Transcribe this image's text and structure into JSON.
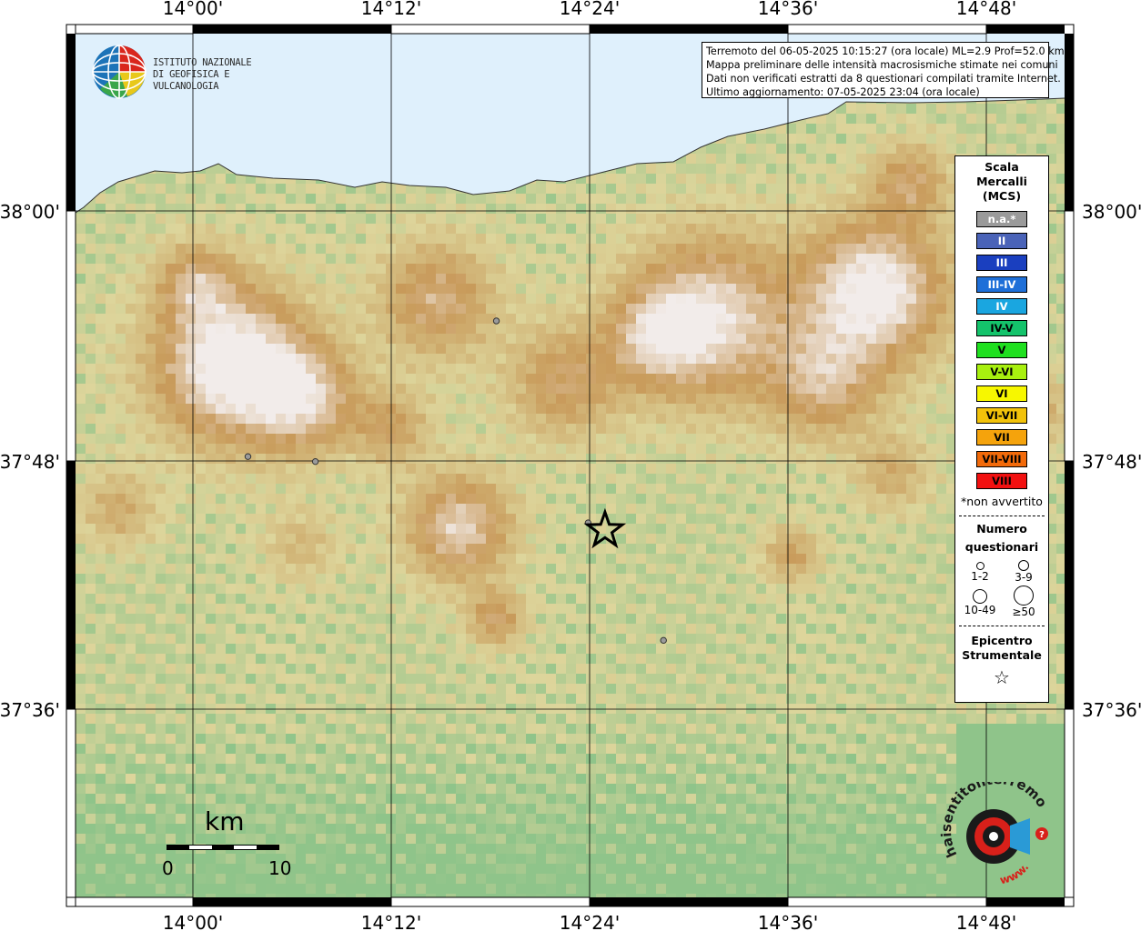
{
  "map": {
    "lon_ticks": [
      "14°00'",
      "14°12'",
      "14°24'",
      "14°36'",
      "14°48'"
    ],
    "lat_ticks": [
      "38°00'",
      "37°48'",
      "37°36'"
    ],
    "colors": {
      "sea": "#dff0fc",
      "land_low": "#8fc48a",
      "land_mid": "#ddd59b",
      "land_high": "#c89a5a",
      "peak": "#f2ecea",
      "grid": "#000000"
    }
  },
  "logo": {
    "line1": "ISTITUTO NAZIONALE",
    "line2": "DI GEOFISICA E VULCANOLOGIA"
  },
  "info": {
    "line1": "Terremoto del 06-05-2025 10:15:27 (ora locale) ML=2.9 Prof=52.0 km",
    "line2": "Mappa preliminare delle intensità macrosismiche stimate nei comuni",
    "line3": "Dati non verificati estratti da 8 questionari compilati tramite Internet.",
    "line4": "Ultimo aggiornamento: 07-05-2025 23:04 (ora locale)"
  },
  "legend": {
    "title_lines": [
      "Scala",
      "Mercalli",
      "(MCS)"
    ],
    "scale": [
      {
        "label": "n.a.*",
        "color": "#9a9a9a"
      },
      {
        "label": "II",
        "color": "#4a63b8"
      },
      {
        "label": "III",
        "color": "#1a3fbf"
      },
      {
        "label": "III-IV",
        "color": "#1e6fd8"
      },
      {
        "label": "IV",
        "color": "#1aa6e0"
      },
      {
        "label": "IV-V",
        "color": "#14c36b"
      },
      {
        "label": "V",
        "color": "#1fe01f"
      },
      {
        "label": "V-VI",
        "color": "#a8f00f"
      },
      {
        "label": "VI",
        "color": "#f7f700"
      },
      {
        "label": "VI-VII",
        "color": "#f2c20a"
      },
      {
        "label": "VII",
        "color": "#f5a30c"
      },
      {
        "label": "VII-VIII",
        "color": "#f26a0a"
      },
      {
        "label": "VIII",
        "color": "#f21010"
      }
    ],
    "note": "*non avvertito",
    "count_title_lines": [
      "Numero",
      "questionari"
    ],
    "counts": [
      "1-2",
      "3-9",
      "10-49",
      "≥50"
    ],
    "epicenter_lines": [
      "Epicentro",
      "Strumentale"
    ]
  },
  "scalebar": {
    "unit": "km",
    "min": "0",
    "max": "10"
  },
  "watermark": {
    "text": "haisentitoilterremoto.it",
    "site": "www."
  },
  "stations": [
    {
      "lon": 14.306,
      "lat": 37.912
    },
    {
      "lon": 14.0555,
      "lat": 37.8035
    },
    {
      "lon": 14.1235,
      "lat": 37.7995
    },
    {
      "lon": 14.3985,
      "lat": 37.7505
    },
    {
      "lon": 14.4745,
      "lat": 37.6565
    }
  ],
  "epicenter": {
    "lon": 14.4155,
    "lat": 37.7445
  }
}
